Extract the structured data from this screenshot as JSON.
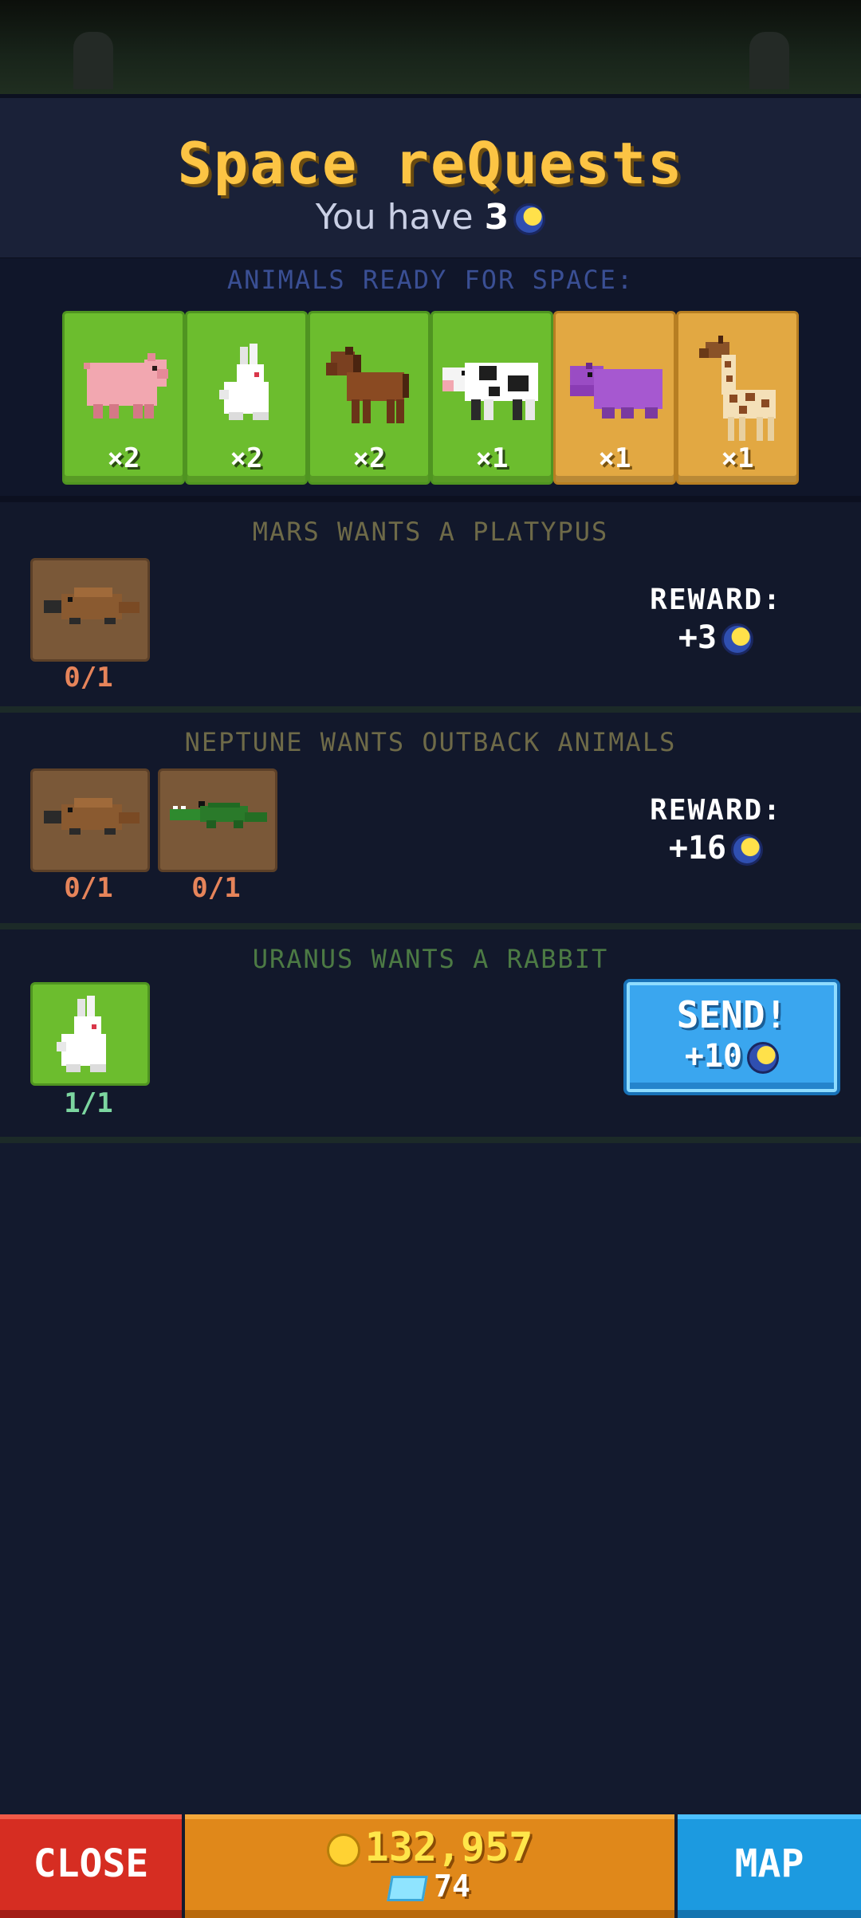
{
  "header": {
    "title": "Space reQuests",
    "subtitle_prefix": "You have",
    "moon_coins": "3"
  },
  "ready": {
    "label": "ANIMALS READY FOR SPACE:",
    "animals": [
      {
        "icon": "pig-icon",
        "count": "×2",
        "tile": "green"
      },
      {
        "icon": "rabbit-icon",
        "count": "×2",
        "tile": "green"
      },
      {
        "icon": "horse-icon",
        "count": "×2",
        "tile": "green"
      },
      {
        "icon": "cow-icon",
        "count": "×1",
        "tile": "green"
      },
      {
        "icon": "hippo-icon",
        "count": "×1",
        "tile": "gold"
      },
      {
        "icon": "giraffe-icon",
        "count": "×1",
        "tile": "gold"
      }
    ]
  },
  "requests": [
    {
      "title": "MARS WANTS A PLATYPUS",
      "slots": [
        {
          "icon": "platypus-icon",
          "progress": "0/1"
        }
      ],
      "reward_label": "REWARD:",
      "reward": "+3"
    },
    {
      "title": "NEPTUNE WANTS OUTBACK ANIMALS",
      "slots": [
        {
          "icon": "platypus-icon",
          "progress": "0/1"
        },
        {
          "icon": "crocodile-icon",
          "progress": "0/1"
        }
      ],
      "reward_label": "REWARD:",
      "reward": "+16"
    },
    {
      "title": "URANUS WANTS A RABBIT",
      "slots": [
        {
          "icon": "rabbit-icon",
          "progress": "1/1"
        }
      ],
      "send_label": "SEND!",
      "reward": "+10"
    }
  ],
  "footer": {
    "close": "CLOSE",
    "cash": "132,957",
    "gems": "74",
    "map": "MAP"
  },
  "colors": {
    "title": "#fcc444",
    "ready_label": "#3a4f94",
    "mars_title": "#6e6a48",
    "neptune_title": "#6e6a48",
    "uranus_title": "#4c7a44",
    "progress_incomplete": "#e6845a",
    "progress_complete": "#7cd6a0"
  }
}
